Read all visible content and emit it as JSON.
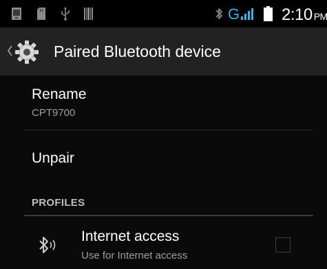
{
  "status_bar": {
    "time": "2:10",
    "ampm": "PM",
    "network": "G",
    "icons": [
      "screenshot-icon",
      "sd-card-icon",
      "usb-icon",
      "barcode-icon",
      "bluetooth-icon",
      "signal-icon",
      "battery-icon"
    ]
  },
  "action_bar": {
    "title": "Paired Bluetooth device",
    "app_icon": "settings-gear-icon"
  },
  "prefs": {
    "rename": {
      "title": "Rename",
      "summary": "CPT9700"
    },
    "unpair": {
      "title": "Unpair"
    }
  },
  "profiles": {
    "header": "PROFILES",
    "items": [
      {
        "title": "Internet access",
        "summary": "Use for Internet access",
        "icon": "bluetooth-share-icon",
        "checked": false
      }
    ]
  },
  "colors": {
    "accent": "#33b5e5",
    "action_bar_bg": "#222222",
    "background": "#0a0a0a"
  }
}
